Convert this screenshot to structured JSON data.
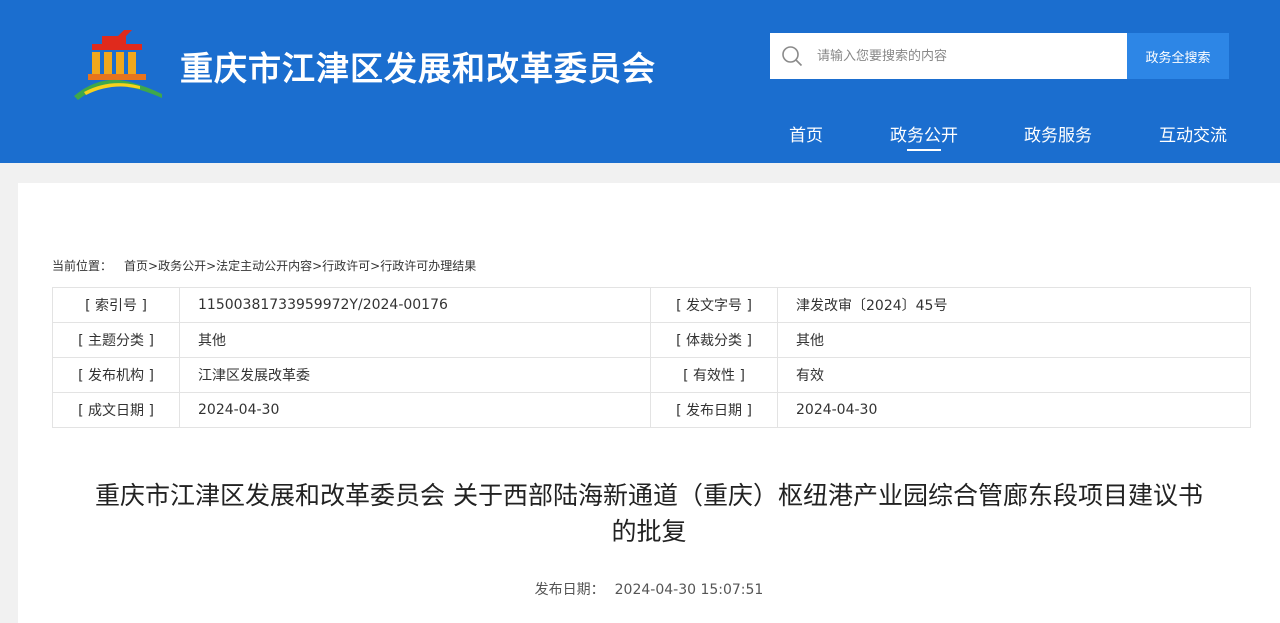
{
  "header": {
    "site_title": "重庆市江津区发展和改革委员会",
    "logo_icon": "government-building-logo-icon",
    "search": {
      "placeholder": "请输入您要搜索的内容",
      "button_label": "政务全搜索",
      "icon": "search-icon"
    },
    "nav": [
      {
        "label": "首页",
        "active": false
      },
      {
        "label": "政务公开",
        "active": true
      },
      {
        "label": "政务服务",
        "active": false
      },
      {
        "label": "互动交流",
        "active": false
      }
    ],
    "colors": {
      "header_bg": "#1b6ecf",
      "search_button": "#2d86e6"
    }
  },
  "breadcrumb": {
    "label": "当前位置：",
    "path": "首页>政务公开>法定主动公开内容>行政许可>行政许可办理结果"
  },
  "meta_table": [
    {
      "k1": "[ 索引号 ]",
      "v1": "11500381733959972Y/2024-00176",
      "k2": "[ 发文字号 ]",
      "v2": "津发改审〔2024〕45号"
    },
    {
      "k1": "[ 主题分类 ]",
      "v1": "其他",
      "k2": "[ 体裁分类 ]",
      "v2": "其他"
    },
    {
      "k1": "[ 发布机构 ]",
      "v1": "江津区发展改革委",
      "k2": "[ 有效性 ]",
      "v2": "有效"
    },
    {
      "k1": "[ 成文日期 ]",
      "v1": "2024-04-30",
      "k2": "[ 发布日期 ]",
      "v2": "2024-04-30"
    }
  ],
  "document": {
    "title_line1": "重庆市江津区发展和改革委员会 关于西部陆海新通道（重庆）枢纽港产业园综合管廊东段项目建议书",
    "title_line2": "的批复",
    "pub_date_label": "发布日期：",
    "pub_date_value": "2024-04-30 15:07:51"
  }
}
